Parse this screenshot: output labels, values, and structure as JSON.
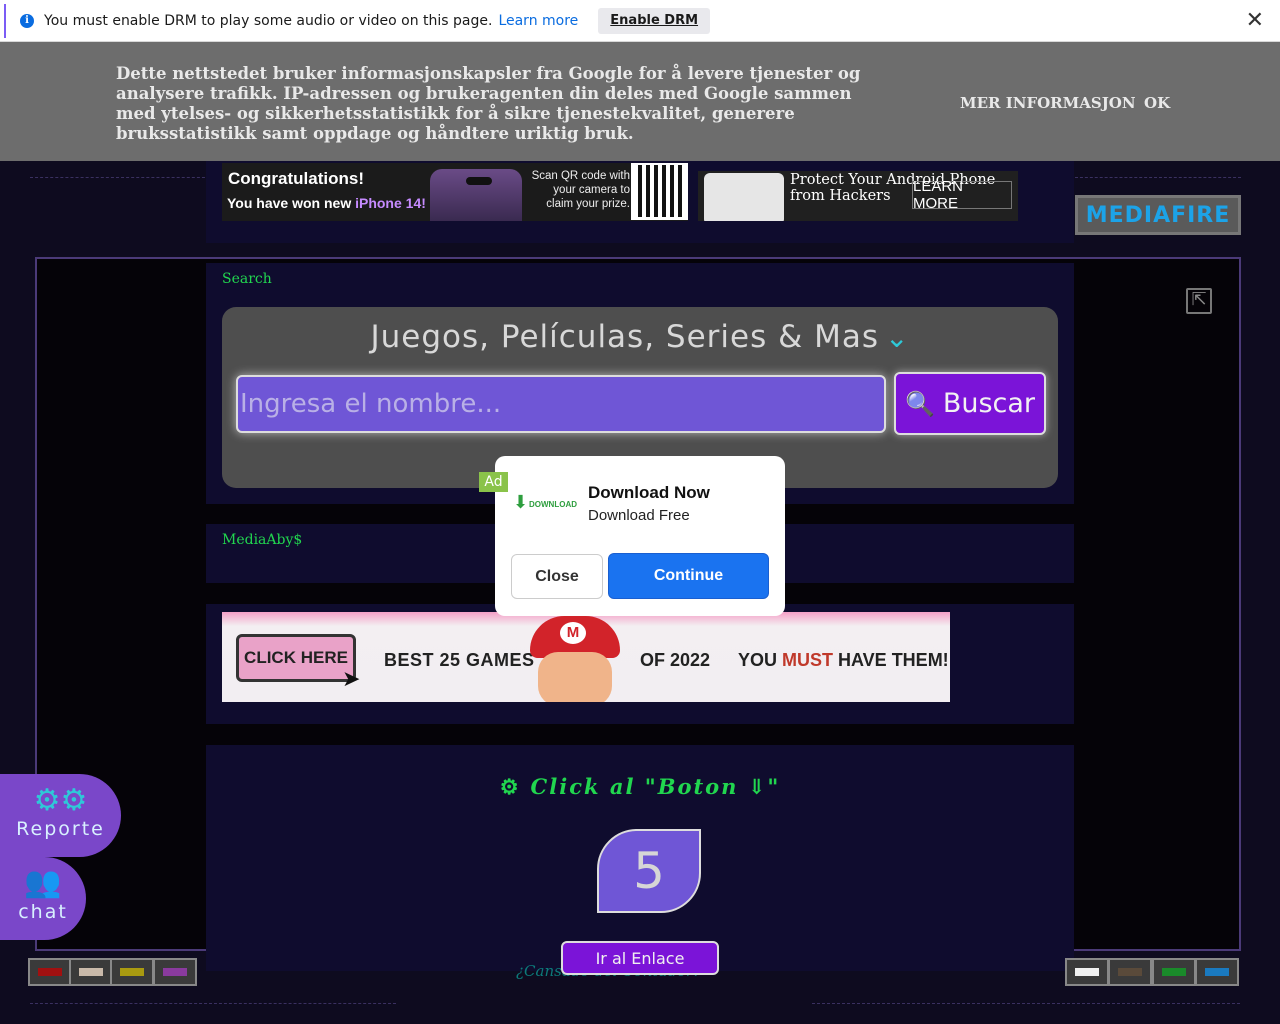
{
  "drm": {
    "message": "You must enable DRM to play some audio or video on this page.",
    "learn_more": "Learn more",
    "enable_button": "Enable DRM",
    "close": "✕"
  },
  "cookie": {
    "text": "Dette nettstedet bruker informasjonskapsler fra Google for å levere tjenester og analysere trafikk. IP-adressen og brukeragenten din deles med Google sammen med ytelses- og sikkerhetsstatistikk for å sikre tjenestekvalitet, generere bruksstatistikk samt oppdage og håndtere uriktig bruk.",
    "more_info": "MER INFORMASJON",
    "ok": "OK"
  },
  "ads": {
    "top": {
      "headline": "Congratulations!",
      "line_prefix": "You have won new ",
      "line_highlight": "iPhone 14!",
      "qr_text": "Scan QR code with your camera to claim your prize."
    },
    "right": {
      "text": "Protect Your Android Phone from Hackers",
      "cta": "LEARN MORE"
    },
    "mario": {
      "click_here": "CLICK HERE",
      "best": "BEST 25 GAMES",
      "year": "OF 2022",
      "must_prefix": "YOU ",
      "must_word": "MUST",
      "must_suffix": " HAVE THEM!"
    }
  },
  "mediafire": "MEDIAFIRE",
  "search": {
    "label": "Search",
    "title": "Juegos, Películas, Series & Mas",
    "placeholder": "Ingresa el nombre...",
    "button": "Buscar"
  },
  "media_label": "MediaAby$",
  "click_boton": "Click al \"Boton ⇓\"",
  "counter": "5",
  "ir_enlace": "Ir al Enlace",
  "ghost_text": "¿Cansado del Contador?",
  "side": {
    "reporte": "Reporte",
    "chat": "chat"
  },
  "swatches_left": [
    "#a11010",
    "#c9b9a9",
    "#a99a10",
    "#8a3a9e"
  ],
  "swatches_right": [
    "#f0f0f0",
    "#5a4a3a",
    "#1a8a2a",
    "#1a7ac0"
  ],
  "modal": {
    "badge": "Ad",
    "logo_text": "DOWNLOAD",
    "title": "Download Now",
    "subtitle": "Download Free",
    "close": "Close",
    "continue": "Continue"
  }
}
